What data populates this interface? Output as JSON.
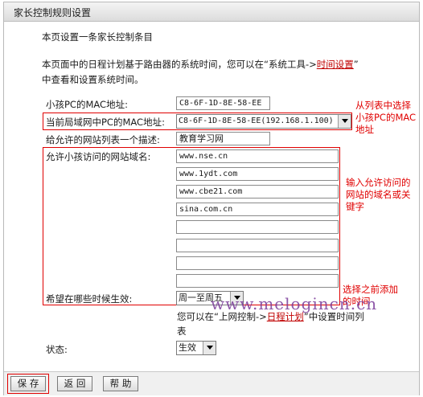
{
  "title": "家长控制规则设置",
  "intro": "本页设置一条家长控制条目",
  "note": {
    "before": "本页面中的日程计划基于路由器的系统时间，您可以在“系统工具->",
    "link": "时间设置",
    "after": "”",
    "line2": "中查看和设置系统时间。"
  },
  "form": {
    "child_mac_label": "小孩PC的MAC地址:",
    "child_mac_value": "C8-6F-1D-8E-58-EE",
    "lan_mac_label": "当前局域网中PC的MAC地址:",
    "lan_mac_selected": "C8-6F-1D-8E-58-EE(192.168.1.100)",
    "desc_label": "给允许的网站列表一个描述:",
    "desc_value": "教育学习网",
    "domains_label": "允许小孩访问的网站域名:",
    "domains": [
      "www.nse.cn",
      "www.1ydt.com",
      "www.cbe21.com",
      "sina.com.cn",
      "",
      "",
      "",
      ""
    ],
    "schedule_label": "希望在哪些时候生效:",
    "schedule_selected": "周一至周五",
    "schedule_note_before": "您可以在“上网控制->",
    "schedule_note_link": "日程计划",
    "schedule_note_after": "”中设置时间列",
    "schedule_note_line2": "表",
    "status_label": "状态:",
    "status_selected": "生效"
  },
  "annotations": {
    "a1": [
      "从列表中选择",
      "小孩PC的MAC",
      "地址"
    ],
    "a2": [
      "输入允许访问的",
      "网站的域名或关",
      "键字"
    ],
    "a3": [
      "选择之前添加",
      "的时间"
    ]
  },
  "watermark": "www.melogincn.cn",
  "buttons": {
    "save": "保 存",
    "back": "返 回",
    "help": "帮 助"
  },
  "colors": {
    "annotation": "#e00000",
    "link": "#c00000"
  }
}
